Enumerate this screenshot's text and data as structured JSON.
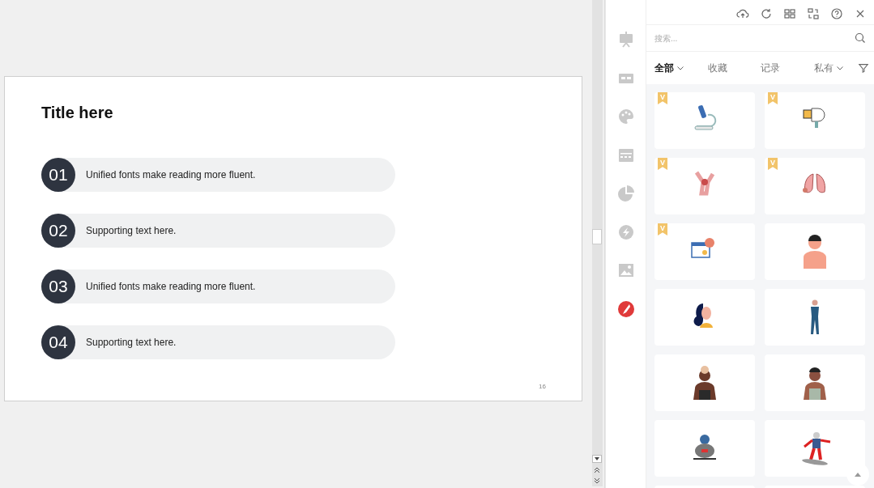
{
  "slide": {
    "title": "Title here",
    "items": [
      {
        "number": "01",
        "text": "Unified fonts make reading more fluent."
      },
      {
        "number": "02",
        "text": "Supporting text here."
      },
      {
        "number": "03",
        "text": "Unified fonts make reading more fluent."
      },
      {
        "number": "04",
        "text": "Supporting text here."
      }
    ],
    "page_number": "16"
  },
  "rail": [
    {
      "selected": false
    },
    {
      "selected": false
    },
    {
      "selected": false
    },
    {
      "selected": false
    },
    {
      "selected": false
    },
    {
      "selected": false
    },
    {
      "selected": false
    },
    {
      "selected": true
    }
  ],
  "search": {
    "placeholder": "搜索..."
  },
  "filters": [
    {
      "label": "全部",
      "selected": true,
      "dropdown": true
    },
    {
      "label": "收藏",
      "selected": false,
      "dropdown": false
    },
    {
      "label": "记录",
      "selected": false,
      "dropdown": false
    },
    {
      "label": "私有",
      "selected": false,
      "dropdown": true
    }
  ],
  "cards": [
    {
      "premium": true,
      "badge": "V"
    },
    {
      "premium": true,
      "badge": "V"
    },
    {
      "premium": true,
      "badge": "V"
    },
    {
      "premium": true,
      "badge": "V"
    },
    {
      "premium": true,
      "badge": "V"
    },
    {
      "premium": false
    },
    {
      "premium": false
    },
    {
      "premium": false
    },
    {
      "premium": false
    },
    {
      "premium": false
    },
    {
      "premium": false
    },
    {
      "premium": false
    },
    {
      "premium": false
    },
    {
      "premium": false
    }
  ]
}
